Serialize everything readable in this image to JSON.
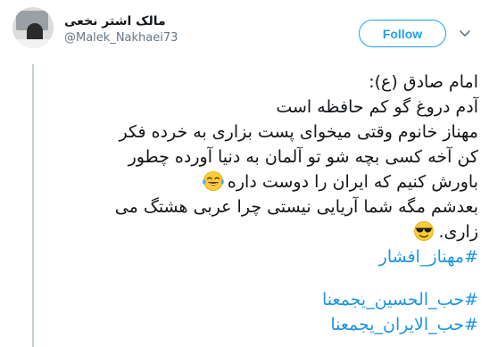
{
  "author": {
    "display_name": "مالک اشتر نخعی",
    "handle": "@Malek_Nakhaei73",
    "avatar_icon": "profile-photo"
  },
  "follow_button": {
    "label": "Follow"
  },
  "caret_icon": "chevron-down-icon",
  "tweet": {
    "lines": [
      "امام صادق (ع):",
      "آدم دروغ گو کم حافظه است",
      "مهناز خانوم وقتی میخوای پست بزاری به خرده فکر",
      "کن آخه کسی بچه شو تو آلمان به دنیا آورده چطور",
      "باورش کنیم که ایران را دوست داره",
      "بعدشم مگه شما آریایی نیستی چرا عربی هشتگ می",
      "زاری."
    ],
    "emoji_1": "face-with-tears-of-joy",
    "emoji_2": "smiling-face-with-sunglasses",
    "hashtags": [
      "#مهناز_افشار",
      "#حب_الحسين_يجمعنا",
      "#حب_الايران_يجمعنا"
    ]
  },
  "colors": {
    "accent": "#1da1f2",
    "link": "#1b95e0",
    "text": "#14171a",
    "secondary": "#657786",
    "thread_line": "#c4cfd6"
  }
}
